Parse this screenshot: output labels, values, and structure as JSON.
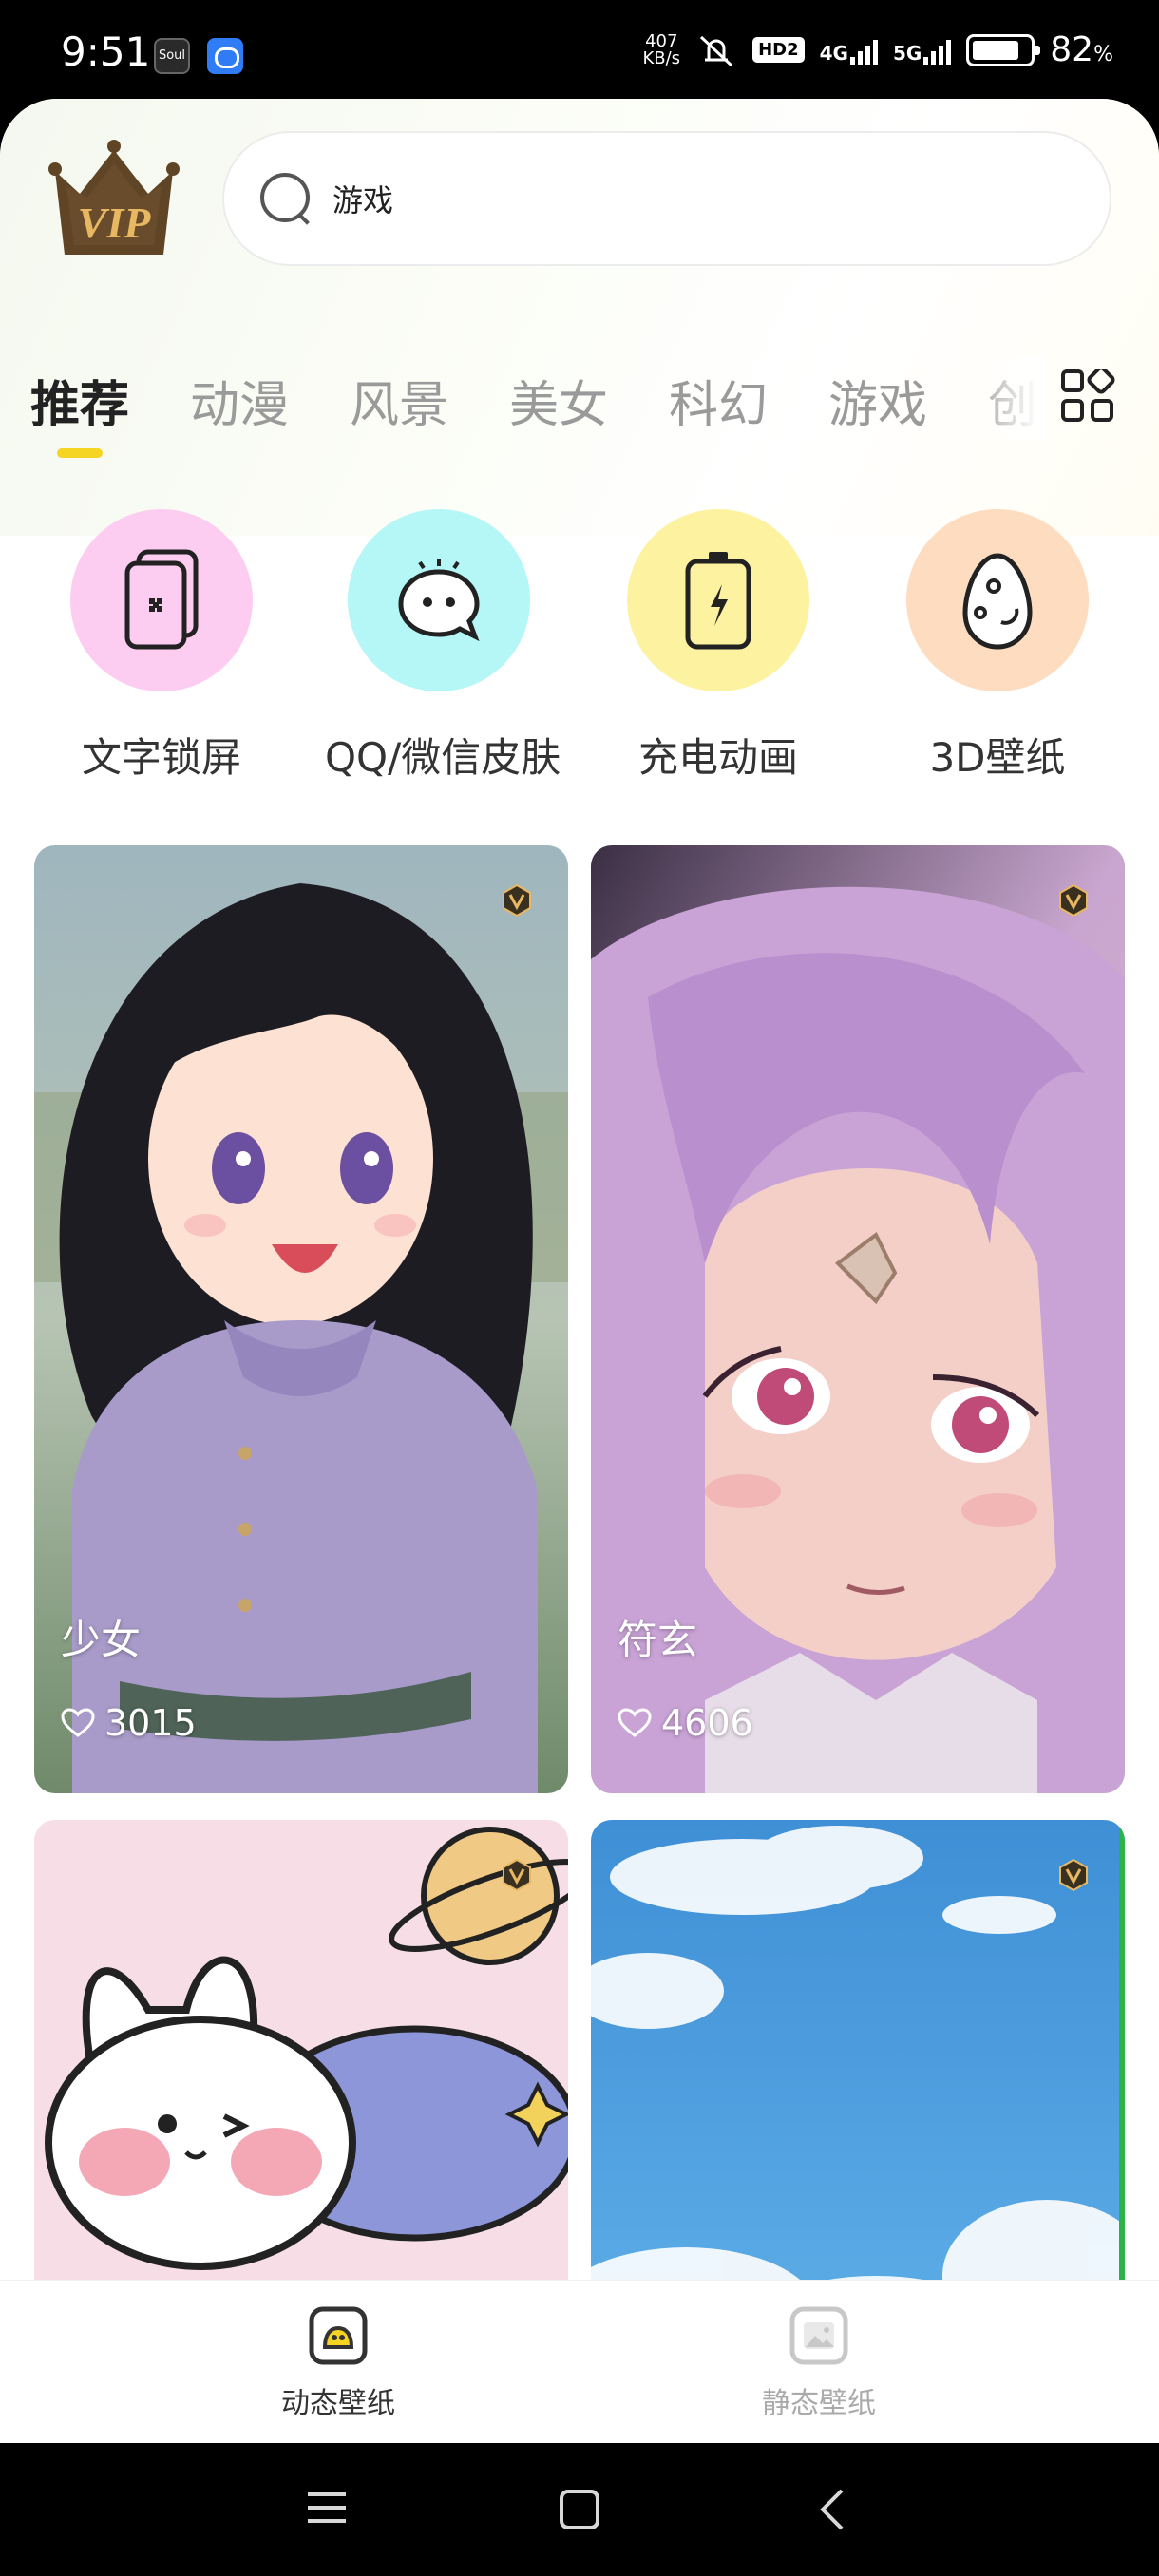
{
  "status_bar": {
    "time": "9:51",
    "app_icon_1": "Soul",
    "net_speed_value": "407",
    "net_speed_unit": "KB/s",
    "hd_label": "HD2",
    "net_4g": "4G",
    "net_5g": "5G",
    "battery_percent": "82",
    "battery_percent_sign": "%",
    "battery_level": 0.82
  },
  "header": {
    "vip_label": "VIP",
    "search_value": "游戏"
  },
  "tabs": [
    {
      "label": "推荐",
      "active": true
    },
    {
      "label": "动漫"
    },
    {
      "label": "风景"
    },
    {
      "label": "美女"
    },
    {
      "label": "科幻"
    },
    {
      "label": "游戏"
    },
    {
      "label": "创"
    }
  ],
  "quick_entries": [
    {
      "label": "文字锁屏",
      "icon": "card-icon",
      "color": "#fdcdf1"
    },
    {
      "label": "QQ/微信皮肤",
      "icon": "chat-bubble-icon",
      "color": "#b5f6f6"
    },
    {
      "label": "充电动画",
      "icon": "battery-charging-icon",
      "color": "#fdf2a0"
    },
    {
      "label": "3D壁纸",
      "icon": "egg-icon",
      "color": "#fddcc0"
    }
  ],
  "wallpapers": [
    {
      "title": "少女",
      "likes": "3015"
    },
    {
      "title": "符玄",
      "likes": "4606"
    },
    {
      "title": "",
      "likes": ""
    },
    {
      "title": "",
      "likes": ""
    }
  ],
  "bottom_nav": {
    "items": [
      {
        "label": "动态壁纸",
        "active": true
      },
      {
        "label": "静态壁纸",
        "active": false
      }
    ]
  },
  "colors": {
    "accent_yellow": "#f6d422",
    "vip_gold": "#e7b861",
    "vip_brown": "#5f4526",
    "active_text": "#222222",
    "inactive_text": "#9a9a9a"
  }
}
